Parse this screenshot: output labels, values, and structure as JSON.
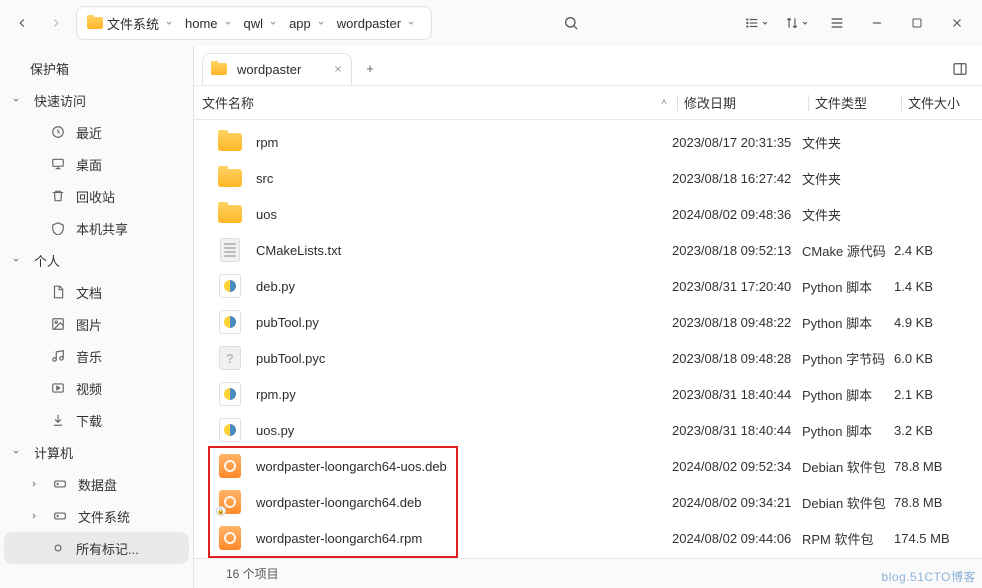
{
  "toolbar": {
    "breadcrumb": [
      {
        "label": "文件系统",
        "hasIcon": true
      },
      {
        "label": "home"
      },
      {
        "label": "qwl"
      },
      {
        "label": "app"
      },
      {
        "label": "wordpaster"
      }
    ]
  },
  "sidebar": {
    "safebox": "保护箱",
    "sections": [
      {
        "title": "快速访问",
        "items": [
          {
            "icon": "clock",
            "label": "最近"
          },
          {
            "icon": "desktop",
            "label": "桌面"
          },
          {
            "icon": "trash",
            "label": "回收站"
          },
          {
            "icon": "share",
            "label": "本机共享"
          }
        ]
      },
      {
        "title": "个人",
        "items": [
          {
            "icon": "doc",
            "label": "文档"
          },
          {
            "icon": "image",
            "label": "图片"
          },
          {
            "icon": "music",
            "label": "音乐"
          },
          {
            "icon": "video",
            "label": "视频"
          },
          {
            "icon": "download",
            "label": "下载"
          }
        ]
      },
      {
        "title": "计算机",
        "items": [
          {
            "icon": "disk",
            "label": "数据盘",
            "expandable": true
          },
          {
            "icon": "disk",
            "label": "文件系统",
            "expandable": true
          },
          {
            "icon": "tag",
            "label": "所有标记...",
            "active": true
          }
        ]
      }
    ]
  },
  "tabs": {
    "active": "wordpaster"
  },
  "columns": {
    "name": "文件名称",
    "date": "修改日期",
    "type": "文件类型",
    "size": "文件大小"
  },
  "files": [
    {
      "icon": "folder",
      "name": "rpm",
      "date": "2023/08/17 20:31:35",
      "type": "文件夹",
      "size": ""
    },
    {
      "icon": "folder",
      "name": "src",
      "date": "2023/08/18 16:27:42",
      "type": "文件夹",
      "size": ""
    },
    {
      "icon": "folder",
      "name": "uos",
      "date": "2024/08/02 09:48:36",
      "type": "文件夹",
      "size": ""
    },
    {
      "icon": "text",
      "name": "CMakeLists.txt",
      "date": "2023/08/18 09:52:13",
      "type": "CMake 源代码",
      "size": "2.4 KB"
    },
    {
      "icon": "py",
      "name": "deb.py",
      "date": "2023/08/31 17:20:40",
      "type": "Python 脚本",
      "size": "1.4 KB"
    },
    {
      "icon": "py",
      "name": "pubTool.py",
      "date": "2023/08/18 09:48:22",
      "type": "Python 脚本",
      "size": "4.9 KB"
    },
    {
      "icon": "unknown",
      "name": "pubTool.pyc",
      "date": "2023/08/18 09:48:28",
      "type": "Python 字节码",
      "size": "6.0 KB"
    },
    {
      "icon": "py",
      "name": "rpm.py",
      "date": "2023/08/31 18:40:44",
      "type": "Python 脚本",
      "size": "2.1 KB"
    },
    {
      "icon": "py",
      "name": "uos.py",
      "date": "2023/08/31 18:40:44",
      "type": "Python 脚本",
      "size": "3.2 KB"
    },
    {
      "icon": "pkg",
      "name": "wordpaster-loongarch64-uos.deb",
      "date": "2024/08/02 09:52:34",
      "type": "Debian 软件包",
      "size": "78.8 MB"
    },
    {
      "icon": "pkg",
      "name": "wordpaster-loongarch64.deb",
      "date": "2024/08/02 09:34:21",
      "type": "Debian 软件包",
      "size": "78.8 MB",
      "locked": true
    },
    {
      "icon": "pkg",
      "name": "wordpaster-loongarch64.rpm",
      "date": "2024/08/02 09:44:06",
      "type": "RPM 软件包",
      "size": "174.5 MB"
    }
  ],
  "status": "16 个项目",
  "watermark": "blog.51CTO博客"
}
